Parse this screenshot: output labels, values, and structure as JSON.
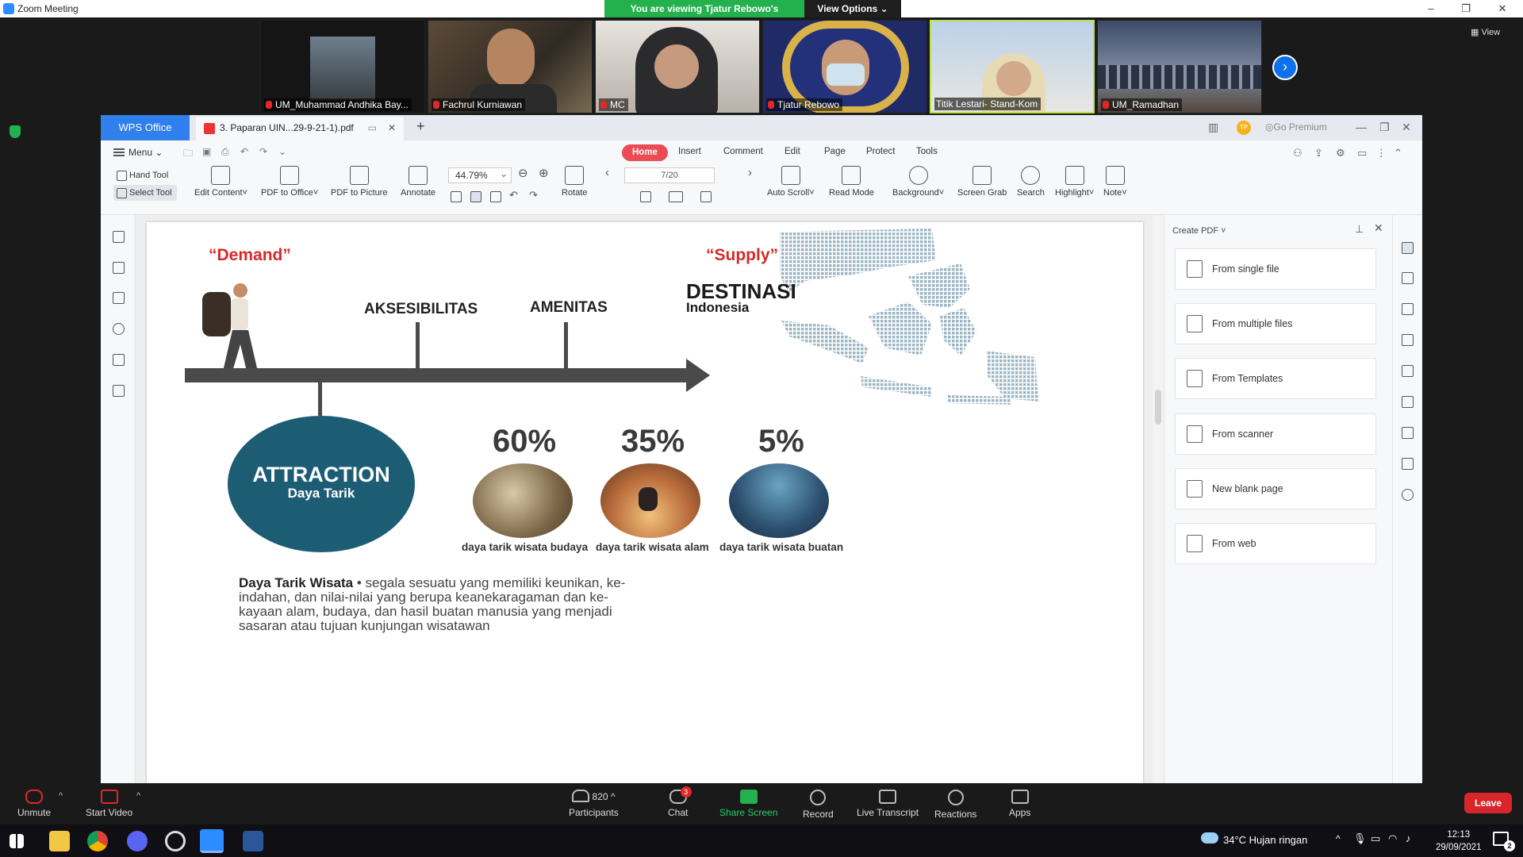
{
  "zoom": {
    "window_title": "Zoom Meeting",
    "viewing_banner": "You are viewing Tjatur Rebowo's screen",
    "view_options": "View Options",
    "view_button": "View",
    "participants_video": [
      {
        "name": "UM_Muhammad Andhika Bay..."
      },
      {
        "name": "Fachrul Kurniawan"
      },
      {
        "name": "MC"
      },
      {
        "name": "Tjatur Rebowo"
      },
      {
        "name": "Titik Lestari- Stand-Kom"
      },
      {
        "name": "UM_Ramadhan"
      }
    ],
    "controls": {
      "unmute": "Unmute",
      "start_video": "Start Video",
      "participants": "Participants",
      "participants_count": "820",
      "chat": "Chat",
      "chat_badge": "3",
      "share_screen": "Share Screen",
      "record": "Record",
      "live_transcript": "Live Transcript",
      "reactions": "Reactions",
      "apps": "Apps",
      "leave": "Leave"
    }
  },
  "wps": {
    "app_tab": "WPS Office",
    "doc_tab": "3. Paparan UIN...29-9-21-1).pdf",
    "premium_badge": "TP",
    "go_premium": "Go Premium",
    "menu": "Menu",
    "ribbon_tabs": [
      "Home",
      "Insert",
      "Comment",
      "Edit",
      "Page",
      "Protect",
      "Tools"
    ],
    "tools": {
      "hand_tool": "Hand Tool",
      "select_tool": "Select Tool",
      "edit_content": "Edit Content",
      "pdf_to_office": "PDF to Office",
      "pdf_to_picture": "PDF to Picture",
      "annotate": "Annotate",
      "zoom": "44.79%",
      "rotate": "Rotate",
      "page": "7/20",
      "auto_scroll": "Auto Scroll",
      "read_mode": "Read Mode",
      "background": "Background",
      "screen_grab": "Screen Grab",
      "search": "Search",
      "highlight": "Highlight",
      "note": "Note"
    },
    "create_pdf": {
      "title": "Create PDF",
      "items": [
        "From single file",
        "From multiple files",
        "From Templates",
        "From scanner",
        "New blank page",
        "From web"
      ]
    }
  },
  "slide": {
    "demand": "“Demand”",
    "supply": "“Supply”",
    "aksesibilitas": "AKSESIBILITAS",
    "amenitas": "AMENITAS",
    "destinasi": "DESTINASI",
    "indonesia": "Indonesia",
    "attraction": "ATTRACTION",
    "daya_tarik": "Daya Tarik",
    "stats": [
      {
        "pct": "60%",
        "label": "daya tarik wisata budaya"
      },
      {
        "pct": "35%",
        "label": "daya tarik wisata alam"
      },
      {
        "pct": "5%",
        "label": "daya tarik wisata buatan"
      }
    ],
    "definition_term": "Daya Tarik Wisata",
    "definition_lines": [
      "segala sesuatu yang memiliki keunikan, ke-",
      "indahan, dan nilai-nilai yang berupa keanekaragaman dan ke-",
      "kayaan alam, budaya, dan hasil buatan manusia yang menjadi",
      "sasaran atau tujuan kunjungan wisatawan"
    ],
    "colors": {
      "red_text": "#d62a2a",
      "ellipse": "#1c5d74",
      "arrow": "#4a4a4a"
    }
  },
  "taskbar": {
    "weather": "34°C  Hujan ringan",
    "time": "12:13",
    "date": "29/09/2021",
    "notif_count": "2"
  }
}
